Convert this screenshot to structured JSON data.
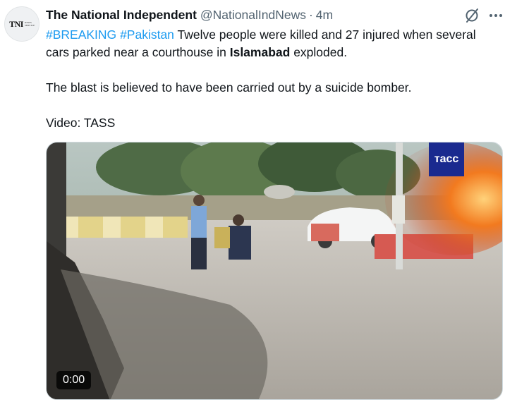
{
  "author": {
    "logo_text": "TNI",
    "logo_subtext": "NEWS SERVICE",
    "name": "The National Independent",
    "handle": "@NationalIndNews",
    "separator": "·",
    "time": "4m"
  },
  "icons": [
    "grok-icon",
    "more-icon"
  ],
  "tweet": {
    "hashtag1": "#BREAKING",
    "hashtag2": "#Pakistan",
    "text1": " Twelve people were killed and 27 injured when several cars parked near a courthouse in ",
    "bold_place": "Islamabad",
    "text2": " exploded.",
    "paragraph2": "The blast is believed to have been carried out by a suicide bomber.",
    "paragraph3": "Video: TASS"
  },
  "media": {
    "watermark": "тасс",
    "timestamp": "0:00"
  },
  "colors": {
    "link": "#1d9bf0",
    "secondary_text": "#536471",
    "primary_text": "#0f1419",
    "tass_badge": "#1a2a8f"
  }
}
